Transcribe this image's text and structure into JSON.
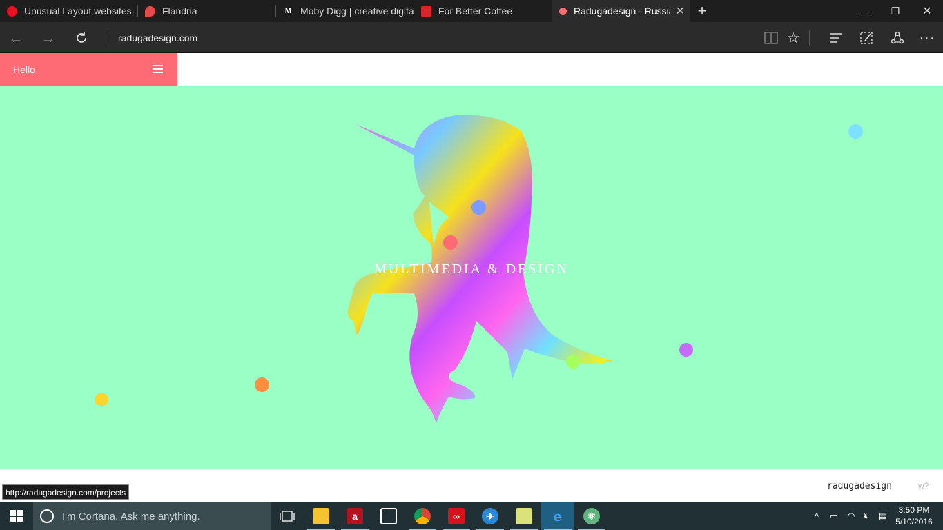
{
  "browser": {
    "tabs": [
      {
        "title": "Unusual Layout websites, pa",
        "favicon": "red-circle-icon",
        "color": "#e81123"
      },
      {
        "title": "Flandria",
        "favicon": "red-bird-icon",
        "color": "#e64a4a"
      },
      {
        "title": "Moby Digg | creative digital",
        "favicon": "m-letter-icon",
        "glyph": "M"
      },
      {
        "title": "For Better Coffee",
        "favicon": "red-cup-icon",
        "color": "#d9262e"
      },
      {
        "title": "Radugadesign - Russiar",
        "favicon": "pink-dot-icon",
        "color": "#ff6b75",
        "active": true
      }
    ],
    "address": "radugadesign.com"
  },
  "site": {
    "menu_label": "Hello",
    "tagline": "MULTIMEDIA & DESIGN",
    "brand": "radugadesign",
    "brand_suffix": "w?",
    "status_url": "http://radugadesign.com/projects",
    "colors": {
      "menu_bg": "#ff6b75",
      "hero_bg": "#99ffc5",
      "dots": [
        "#7ee0ff",
        "#7b9bff",
        "#ff6b75",
        "#c66bff",
        "#a5ff5c",
        "#ff8f3f",
        "#ffd52e"
      ]
    }
  },
  "taskbar": {
    "search_placeholder": "I'm Cortana. Ask me anything.",
    "time": "3:50 PM",
    "date": "5/10/2016",
    "apps": [
      "task-view",
      "file-explorer",
      "app-red",
      "store",
      "chrome",
      "creative-cloud",
      "app-blue",
      "folder-app",
      "edge",
      "atom"
    ]
  }
}
